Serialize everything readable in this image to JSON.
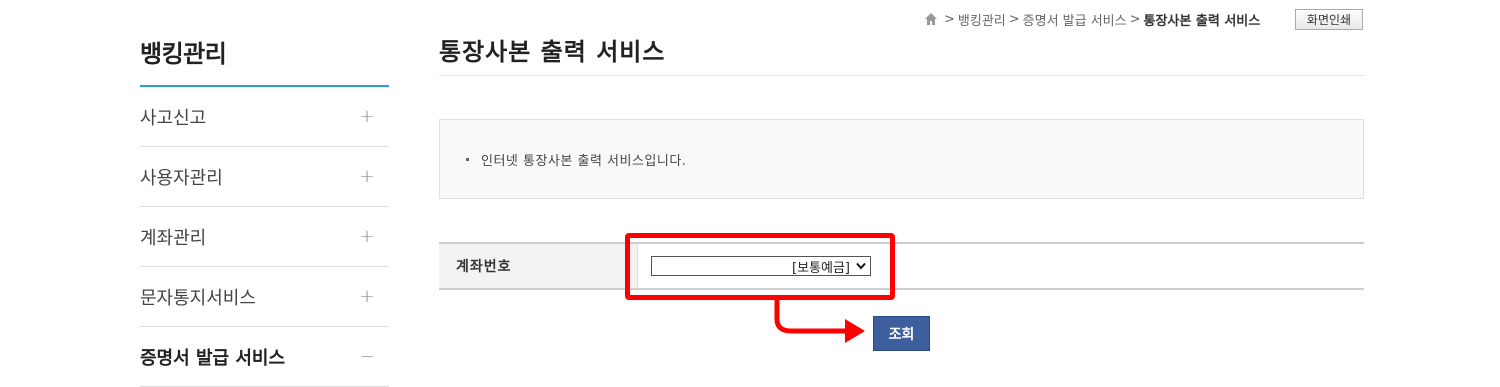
{
  "breadcrumb": {
    "home_icon": "home-icon",
    "items": [
      "뱅킹관리",
      "증명서 발급 서비스"
    ],
    "current": "통장사본 출력 서비스",
    "print_label": "화면인쇄"
  },
  "sidebar": {
    "title": "뱅킹관리",
    "accent_color": "#2a9fd6",
    "items": [
      {
        "label": "사고신고",
        "icon": "+"
      },
      {
        "label": "사용자관리",
        "icon": "+"
      },
      {
        "label": "계좌관리",
        "icon": "+"
      },
      {
        "label": "문자통지서비스",
        "icon": "+"
      },
      {
        "label": "증명서 발급 서비스",
        "icon": "−"
      }
    ]
  },
  "main": {
    "title": "통장사본 출력 서비스",
    "notice": "인터넷 통장사본 출력 서비스입니다.",
    "form": {
      "account_label": "계좌번호",
      "account_value": "[보통예금]"
    },
    "search_label": "조회",
    "button_color": "#3d5f9e",
    "highlight_color": "#ff0000"
  }
}
